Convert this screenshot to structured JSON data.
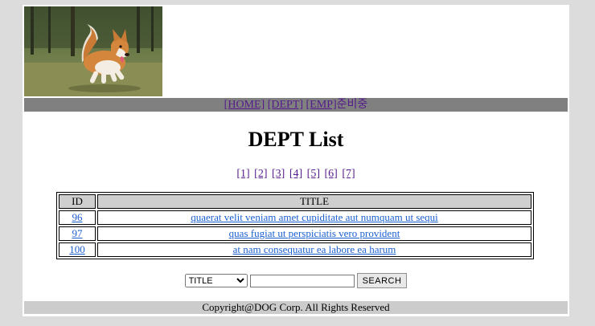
{
  "nav": {
    "items": [
      "[HOME]",
      "[DEPT]",
      "[EMP]"
    ],
    "soon": "준비중"
  },
  "main": {
    "title": "DEPT List",
    "pages": [
      "[1]",
      "[2]",
      "[3]",
      "[4]",
      "[5]",
      "[6]",
      "[7]"
    ]
  },
  "table": {
    "headers": [
      "ID",
      "TITLE"
    ],
    "rows": [
      {
        "id": "96",
        "title": "quaerat velit veniam amet cupiditate aut numquam ut sequi"
      },
      {
        "id": "97",
        "title": "quas fugiat ut perspiciatis vero provident"
      },
      {
        "id": "100",
        "title": "at nam consequatur ea labore ea harum"
      }
    ]
  },
  "search": {
    "selected_option": "TITLE",
    "input_value": "",
    "button_label": "SEARCH"
  },
  "footer": {
    "text": "Copyright@DOG Corp. All Rights Reserved"
  }
}
